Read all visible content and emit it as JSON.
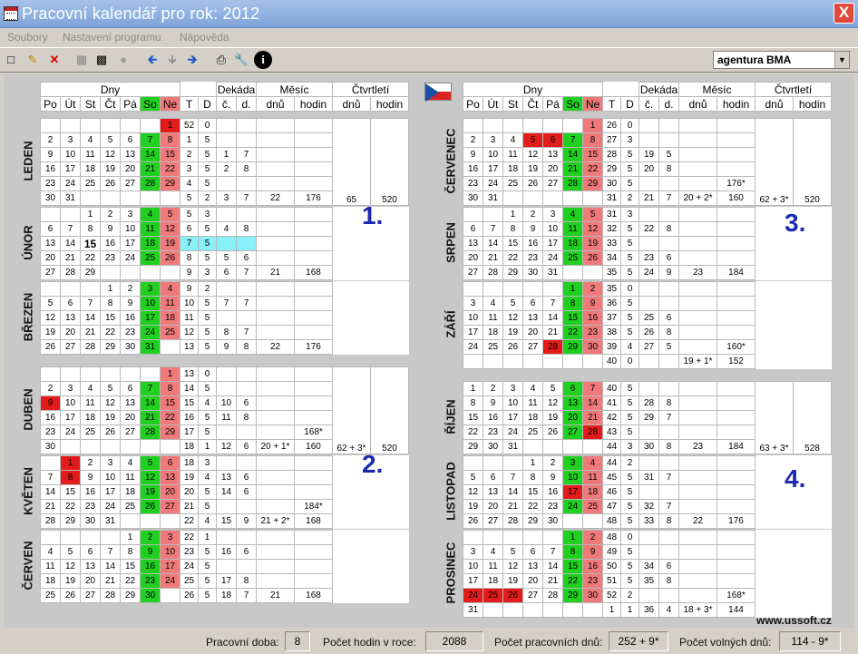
{
  "window": {
    "title": "Pracovní kalendář pro rok: 2012",
    "close": "X"
  },
  "menu": [
    "Soubory",
    "Nastavení programu",
    "Nápověda"
  ],
  "toolbar": {
    "agency": "agentura BMA"
  },
  "headers": {
    "days_group": "Dny",
    "dekada": "Dekáda",
    "mesic": "Měsíc",
    "ctvrtleti": "Čtvrtletí",
    "days": [
      "Po",
      "Út",
      "St",
      "Čt",
      "Pá",
      "So",
      "Ne"
    ],
    "t": "T",
    "d": "D",
    "c": "č.",
    "dd": "d.",
    "dnu": "dnů",
    "hodin": "hodin"
  },
  "left_blocks": [
    {
      "name": "LEDEN",
      "rows": [
        [
          "",
          "",
          "",
          "",
          "",
          "",
          "1",
          "52",
          "0",
          "",
          "",
          "",
          ""
        ],
        [
          "2",
          "3",
          "4",
          "5",
          "6",
          "7",
          "8",
          "1",
          "5",
          "",
          "",
          "",
          ""
        ],
        [
          "9",
          "10",
          "11",
          "12",
          "13",
          "14",
          "15",
          "2",
          "5",
          "1",
          "7",
          "",
          ""
        ],
        [
          "16",
          "17",
          "18",
          "19",
          "20",
          "21",
          "22",
          "3",
          "5",
          "2",
          "8",
          "",
          ""
        ],
        [
          "23",
          "24",
          "25",
          "26",
          "27",
          "28",
          "29",
          "4",
          "5",
          "",
          "",
          "",
          ""
        ],
        [
          "30",
          "31",
          "",
          "",
          "",
          "",
          "",
          "5",
          "2",
          "3",
          "7",
          "22",
          "176"
        ]
      ]
    },
    {
      "name": "ÚNOR",
      "rows": [
        [
          "",
          "",
          "1",
          "2",
          "3",
          "4",
          "5",
          "5",
          "3",
          "",
          "",
          "",
          ""
        ],
        [
          "6",
          "7",
          "8",
          "9",
          "10",
          "11",
          "12",
          "6",
          "5",
          "4",
          "8",
          "",
          ""
        ],
        [
          "13",
          "14",
          "15",
          "16",
          "17",
          "18",
          "19",
          "7",
          "5",
          "",
          "",
          "",
          ""
        ],
        [
          "20",
          "21",
          "22",
          "23",
          "24",
          "25",
          "26",
          "8",
          "5",
          "5",
          "6",
          "",
          ""
        ],
        [
          "27",
          "28",
          "29",
          "",
          "",
          "",
          "",
          "9",
          "3",
          "6",
          "7",
          "21",
          "168"
        ]
      ]
    },
    {
      "name": "BŘEZEN",
      "rows": [
        [
          "",
          "",
          "",
          "1",
          "2",
          "3",
          "4",
          "9",
          "2",
          "",
          "",
          "",
          ""
        ],
        [
          "5",
          "6",
          "7",
          "8",
          "9",
          "10",
          "11",
          "10",
          "5",
          "7",
          "7",
          "",
          ""
        ],
        [
          "12",
          "13",
          "14",
          "15",
          "16",
          "17",
          "18",
          "11",
          "5",
          "",
          "",
          "",
          ""
        ],
        [
          "19",
          "20",
          "21",
          "22",
          "23",
          "24",
          "25",
          "12",
          "5",
          "8",
          "7",
          "",
          ""
        ],
        [
          "26",
          "27",
          "28",
          "29",
          "30",
          "31",
          "",
          "13",
          "5",
          "9",
          "8",
          "22",
          "176"
        ]
      ]
    },
    {
      "name": "DUBEN",
      "rows": [
        [
          "",
          "",
          "",
          "",
          "",
          "",
          "1",
          "13",
          "0",
          "",
          "",
          "",
          ""
        ],
        [
          "2",
          "3",
          "4",
          "5",
          "6",
          "7",
          "8",
          "14",
          "5",
          "",
          "",
          "",
          ""
        ],
        [
          "9",
          "10",
          "11",
          "12",
          "13",
          "14",
          "15",
          "15",
          "4",
          "10",
          "6",
          "",
          ""
        ],
        [
          "16",
          "17",
          "18",
          "19",
          "20",
          "21",
          "22",
          "16",
          "5",
          "11",
          "8",
          "",
          ""
        ],
        [
          "23",
          "24",
          "25",
          "26",
          "27",
          "28",
          "29",
          "17",
          "5",
          "",
          "",
          "",
          "168*"
        ],
        [
          "30",
          "",
          "",
          "",
          "",
          "",
          "",
          "18",
          "1",
          "12",
          "6",
          "20 + 1*",
          "160"
        ]
      ]
    },
    {
      "name": "KVĚTEN",
      "rows": [
        [
          "",
          "1",
          "2",
          "3",
          "4",
          "5",
          "6",
          "18",
          "3",
          "",
          "",
          "",
          ""
        ],
        [
          "7",
          "8",
          "9",
          "10",
          "11",
          "12",
          "13",
          "19",
          "4",
          "13",
          "6",
          "",
          ""
        ],
        [
          "14",
          "15",
          "16",
          "17",
          "18",
          "19",
          "20",
          "20",
          "5",
          "14",
          "6",
          "",
          ""
        ],
        [
          "21",
          "22",
          "23",
          "24",
          "25",
          "26",
          "27",
          "21",
          "5",
          "",
          "",
          "",
          "184*"
        ],
        [
          "28",
          "29",
          "30",
          "31",
          "",
          "",
          "",
          "22",
          "4",
          "15",
          "9",
          "21 + 2*",
          "168"
        ]
      ]
    },
    {
      "name": "ČERVEN",
      "rows": [
        [
          "",
          "",
          "",
          "",
          "1",
          "2",
          "3",
          "22",
          "1",
          "",
          "",
          "",
          ""
        ],
        [
          "4",
          "5",
          "6",
          "7",
          "8",
          "9",
          "10",
          "23",
          "5",
          "16",
          "6",
          "",
          ""
        ],
        [
          "11",
          "12",
          "13",
          "14",
          "15",
          "16",
          "17",
          "24",
          "5",
          "",
          "",
          "",
          ""
        ],
        [
          "18",
          "19",
          "20",
          "21",
          "22",
          "23",
          "24",
          "25",
          "5",
          "17",
          "8",
          "",
          ""
        ],
        [
          "25",
          "26",
          "27",
          "28",
          "29",
          "30",
          "",
          "26",
          "5",
          "18",
          "7",
          "21",
          "168"
        ]
      ]
    }
  ],
  "right_blocks": [
    {
      "name": "ČERVENEC",
      "rows": [
        [
          "",
          "",
          "",
          "",
          "",
          "",
          "1",
          "26",
          "0",
          "",
          "",
          "",
          ""
        ],
        [
          "2",
          "3",
          "4",
          "5",
          "6",
          "7",
          "8",
          "27",
          "3",
          "",
          "",
          "",
          ""
        ],
        [
          "9",
          "10",
          "11",
          "12",
          "13",
          "14",
          "15",
          "28",
          "5",
          "19",
          "5",
          "",
          ""
        ],
        [
          "16",
          "17",
          "18",
          "19",
          "20",
          "21",
          "22",
          "29",
          "5",
          "20",
          "8",
          "",
          ""
        ],
        [
          "23",
          "24",
          "25",
          "26",
          "27",
          "28",
          "29",
          "30",
          "5",
          "",
          "",
          "",
          "176*"
        ],
        [
          "30",
          "31",
          "",
          "",
          "",
          "",
          "",
          "31",
          "2",
          "21",
          "7",
          "20 + 2*",
          "160"
        ]
      ]
    },
    {
      "name": "SRPEN",
      "rows": [
        [
          "",
          "",
          "1",
          "2",
          "3",
          "4",
          "5",
          "31",
          "3",
          "",
          "",
          "",
          ""
        ],
        [
          "6",
          "7",
          "8",
          "9",
          "10",
          "11",
          "12",
          "32",
          "5",
          "22",
          "8",
          "",
          ""
        ],
        [
          "13",
          "14",
          "15",
          "16",
          "17",
          "18",
          "19",
          "33",
          "5",
          "",
          "",
          "",
          ""
        ],
        [
          "20",
          "21",
          "22",
          "23",
          "24",
          "25",
          "26",
          "34",
          "5",
          "23",
          "6",
          "",
          ""
        ],
        [
          "27",
          "28",
          "29",
          "30",
          "31",
          "",
          "",
          "35",
          "5",
          "24",
          "9",
          "23",
          "184"
        ]
      ]
    },
    {
      "name": "ZÁŘÍ",
      "rows": [
        [
          "",
          "",
          "",
          "",
          "",
          "1",
          "2",
          "35",
          "0",
          "",
          "",
          "",
          ""
        ],
        [
          "3",
          "4",
          "5",
          "6",
          "7",
          "8",
          "9",
          "36",
          "5",
          "",
          "",
          "",
          ""
        ],
        [
          "10",
          "11",
          "12",
          "13",
          "14",
          "15",
          "16",
          "37",
          "5",
          "25",
          "6",
          "",
          ""
        ],
        [
          "17",
          "18",
          "19",
          "20",
          "21",
          "22",
          "23",
          "38",
          "5",
          "26",
          "8",
          "",
          ""
        ],
        [
          "24",
          "25",
          "26",
          "27",
          "28",
          "29",
          "30",
          "39",
          "4",
          "27",
          "5",
          "",
          "160*"
        ],
        [
          "",
          "",
          "",
          "",
          "",
          "",
          "",
          "40",
          "0",
          "",
          "",
          "19 + 1*",
          "152"
        ]
      ]
    },
    {
      "name": "ŘÍJEN",
      "rows": [
        [
          "1",
          "2",
          "3",
          "4",
          "5",
          "6",
          "7",
          "40",
          "5",
          "",
          "",
          "",
          ""
        ],
        [
          "8",
          "9",
          "10",
          "11",
          "12",
          "13",
          "14",
          "41",
          "5",
          "28",
          "8",
          "",
          ""
        ],
        [
          "15",
          "16",
          "17",
          "18",
          "19",
          "20",
          "21",
          "42",
          "5",
          "29",
          "7",
          "",
          ""
        ],
        [
          "22",
          "23",
          "24",
          "25",
          "26",
          "27",
          "28",
          "43",
          "5",
          "",
          "",
          "",
          ""
        ],
        [
          "29",
          "30",
          "31",
          "",
          "",
          "",
          "",
          "44",
          "3",
          "30",
          "8",
          "23",
          "184"
        ]
      ]
    },
    {
      "name": "LISTOPAD",
      "rows": [
        [
          "",
          "",
          "",
          "1",
          "2",
          "3",
          "4",
          "44",
          "2",
          "",
          "",
          "",
          ""
        ],
        [
          "5",
          "6",
          "7",
          "8",
          "9",
          "10",
          "11",
          "45",
          "5",
          "31",
          "7",
          "",
          ""
        ],
        [
          "12",
          "13",
          "14",
          "15",
          "16",
          "17",
          "18",
          "46",
          "5",
          "",
          "",
          "",
          ""
        ],
        [
          "19",
          "20",
          "21",
          "22",
          "23",
          "24",
          "25",
          "47",
          "5",
          "32",
          "7",
          "",
          ""
        ],
        [
          "26",
          "27",
          "28",
          "29",
          "30",
          "",
          "",
          "48",
          "5",
          "33",
          "8",
          "22",
          "176"
        ]
      ]
    },
    {
      "name": "PROSINEC",
      "rows": [
        [
          "",
          "",
          "",
          "",
          "",
          "1",
          "2",
          "48",
          "0",
          "",
          "",
          "",
          ""
        ],
        [
          "3",
          "4",
          "5",
          "6",
          "7",
          "8",
          "9",
          "49",
          "5",
          "",
          "",
          "",
          ""
        ],
        [
          "10",
          "11",
          "12",
          "13",
          "14",
          "15",
          "16",
          "50",
          "5",
          "34",
          "6",
          "",
          ""
        ],
        [
          "17",
          "18",
          "19",
          "20",
          "21",
          "22",
          "23",
          "51",
          "5",
          "35",
          "8",
          "",
          ""
        ],
        [
          "24",
          "25",
          "26",
          "27",
          "28",
          "29",
          "30",
          "52",
          "2",
          "",
          "",
          "",
          "168*"
        ],
        [
          "31",
          "",
          "",
          "",
          "",
          "",
          "",
          "1",
          "1",
          "36",
          "4",
          "18 + 3*",
          "144"
        ]
      ]
    }
  ],
  "quarters": [
    {
      "label": "1.",
      "dnu": "65",
      "hodin": "520"
    },
    {
      "label": "2.",
      "dnu": "62 + 3*",
      "hodin": "520"
    },
    {
      "label": "3.",
      "dnu": "62 + 3*",
      "hodin": "520"
    },
    {
      "label": "4.",
      "dnu": "63 + 3*",
      "hodin": "528"
    }
  ],
  "website": "www.ussoft.cz",
  "status": {
    "l1": "Pracovní doba:",
    "v1": "8",
    "l2": "Počet hodin v roce:",
    "v2": "2088",
    "l3": "Počet pracovních dnů:",
    "v3": "252 + 9*",
    "l4": "Počet volných dnů:",
    "v4": "114 - 9*"
  },
  "colors": {
    "weekend_sat": "#20d020",
    "weekend_sun": "#f07a7a",
    "holiday": "#e41b1b",
    "today": "#88f0f8",
    "quarter_label": "#1b29b0"
  }
}
